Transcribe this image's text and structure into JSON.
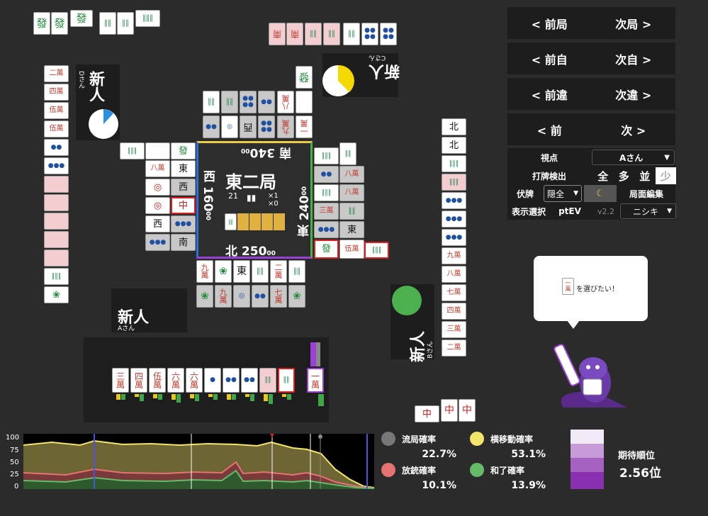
{
  "nav": {
    "prev_round": "< 前局",
    "next_round": "次局 >",
    "prev_self": "< 前自",
    "next_self": "次自 >",
    "prev_diff": "< 前違",
    "next_diff": "次違 >",
    "prev": "< 前",
    "next": "次 >"
  },
  "controls": {
    "viewpoint_label": "視点",
    "viewpoint_value": "Aさん",
    "discard_check_label": "打牌検出",
    "discard_check_options": [
      "全",
      "多",
      "並",
      "少"
    ],
    "hidden_label": "伏牌",
    "hidden_value": "隠全",
    "moon_icon": "moon-icon",
    "board_edit_label": "局面編集",
    "display_label": "表示選択",
    "display_value": "ptEV",
    "version": "v2.2",
    "nishiki_value": "ニシキ"
  },
  "board": {
    "round": "東二局",
    "honba": "21",
    "tsumibo_x1": "×1",
    "tsumibo_x0": "×0",
    "south_score": "南 340",
    "south_sub": "00",
    "west_score": "西 160",
    "west_sub": "00",
    "east_score": "東 240",
    "east_sub": "00",
    "north_score": "北 250",
    "north_sub": "00"
  },
  "players": {
    "bottom": {
      "name": "新人",
      "sub": "Aさん"
    },
    "right": {
      "name": "新人",
      "sub": "Bさん"
    },
    "top": {
      "name": "新人",
      "sub": "Cさん"
    },
    "left": {
      "name": "新人",
      "sub": "Dさん"
    }
  },
  "hand": [
    {
      "t": "三",
      "s": "萬",
      "k": "m"
    },
    {
      "t": "四",
      "s": "萬",
      "k": "m"
    },
    {
      "t": "伍",
      "s": "萬",
      "k": "m"
    },
    {
      "t": "六",
      "s": "萬",
      "k": "m"
    },
    {
      "t": "六",
      "s": "萬",
      "k": "m"
    },
    {
      "t": "●",
      "s": "",
      "k": "p"
    },
    {
      "t": "●●",
      "s": "",
      "k": "p"
    },
    {
      "t": "●●",
      "s": "",
      "k": "p"
    },
    {
      "t": "‖‖",
      "s": "",
      "k": "s",
      "hl": true
    },
    {
      "t": "‖‖",
      "s": "",
      "k": "s",
      "red": true
    }
  ],
  "drawn": {
    "t": "一",
    "s": "萬",
    "k": "m"
  },
  "speech": {
    "tile": "一萬",
    "text": "を選びたい！"
  },
  "legend": {
    "ryukyoku_label": "流局確率",
    "ryukyoku_value": "22.7%",
    "ryukyoku_color": "#777777",
    "yokoido_label": "横移動確率",
    "yokoido_value": "53.1%",
    "yokoido_color": "#f3e46a",
    "houju_label": "放銃確率",
    "houju_value": "10.1%",
    "houju_color": "#e57373",
    "agari_label": "和了確率",
    "agari_value": "13.9%",
    "agari_color": "#66bb6a",
    "rank_label": "期待順位",
    "rank_value": "2.56位"
  },
  "graph": {
    "yticks": [
      "100",
      "75",
      "50",
      "25",
      "0"
    ]
  },
  "discards": {
    "top_shouts": [
      "中",
      "中",
      "中"
    ]
  }
}
